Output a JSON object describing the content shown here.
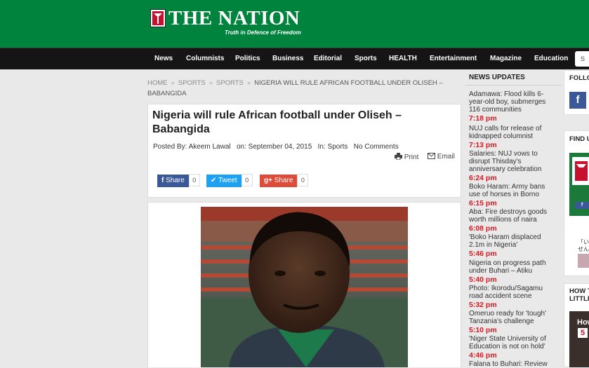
{
  "brand": {
    "name": "THE NATION",
    "tagline": "Truth in Defence of Freedom"
  },
  "nav": [
    "News",
    "Columnists",
    "Politics",
    "Business",
    "Editorial",
    "Sports",
    "HEALTH",
    "Entertainment",
    "Magazine",
    "Education"
  ],
  "search": {
    "placeholder": "S"
  },
  "breadcrumb": [
    "HOME",
    "SPORTS",
    "SPORTS",
    "NIGERIA WILL RULE AFRICAN FOOTBALL UNDER OLISEH – BABANGIDA"
  ],
  "article": {
    "title": "Nigeria will rule African football under Oliseh – Babangida",
    "posted_by": "Posted By:",
    "author": "Akeem Lawal",
    "on": "on: September 04, 2015",
    "in": "In:",
    "category": "Sports",
    "comments": "No Comments",
    "print": "Print",
    "email": "Email"
  },
  "social": [
    {
      "label": "Share",
      "count": "0",
      "color": "#3b5998",
      "icon": "f"
    },
    {
      "label": "Tweet",
      "count": "0",
      "color": "#1da1f2",
      "icon": "twitter-bird"
    },
    {
      "label": "Share",
      "count": "0",
      "color": "#dd4b39",
      "icon": "g+"
    }
  ],
  "news_updates": {
    "title": "NEWS UPDATES",
    "items": [
      {
        "headline": "Adamawa: Flood kills 6-year-old boy, submerges 116  communities",
        "time": "7:18 pm"
      },
      {
        "headline": "NUJ calls for release of kidnapped columnist",
        "time": "7:13 pm"
      },
      {
        "headline": "Salaries: NUJ vows to disrupt Thisday's anniversary celebration",
        "time": "6:24 pm"
      },
      {
        "headline": "Boko Haram: Army bans use of horses in Borno",
        "time": "6:15 pm"
      },
      {
        "headline": "Aba: Fire destroys goods worth millions of naira",
        "time": "6:08 pm"
      },
      {
        "headline": "'Boko Haram displaced 2.1m in Nigeria'",
        "time": "5:46 pm"
      },
      {
        "headline": "Nigeria on progress path under Buhari – Atiku",
        "time": "5:40 pm"
      },
      {
        "headline": "Photo: Ikorodu/Sagamu road accident scene",
        "time": "5:32 pm"
      },
      {
        "headline": "Omeruo ready for 'tough' Tanzania's challenge",
        "time": "5:10 pm"
      },
      {
        "headline": "'Niger State University of Education is not on hold'",
        "time": "4:46 pm"
      },
      {
        "headline": "Falana to Buhari: Review",
        "time": ""
      }
    ]
  },
  "right_col": {
    "follow": "FOLLO",
    "find": "FIND U",
    "how_title_1": "HOW T",
    "how_title_2": "LITTLI",
    "video_text": "How",
    "video_num": "5",
    "fb_text": "「い",
    "fb_text2": "せん"
  },
  "colors": {
    "header_green": "#00843d",
    "nav_black": "#151515",
    "time_red": "#d71920"
  }
}
